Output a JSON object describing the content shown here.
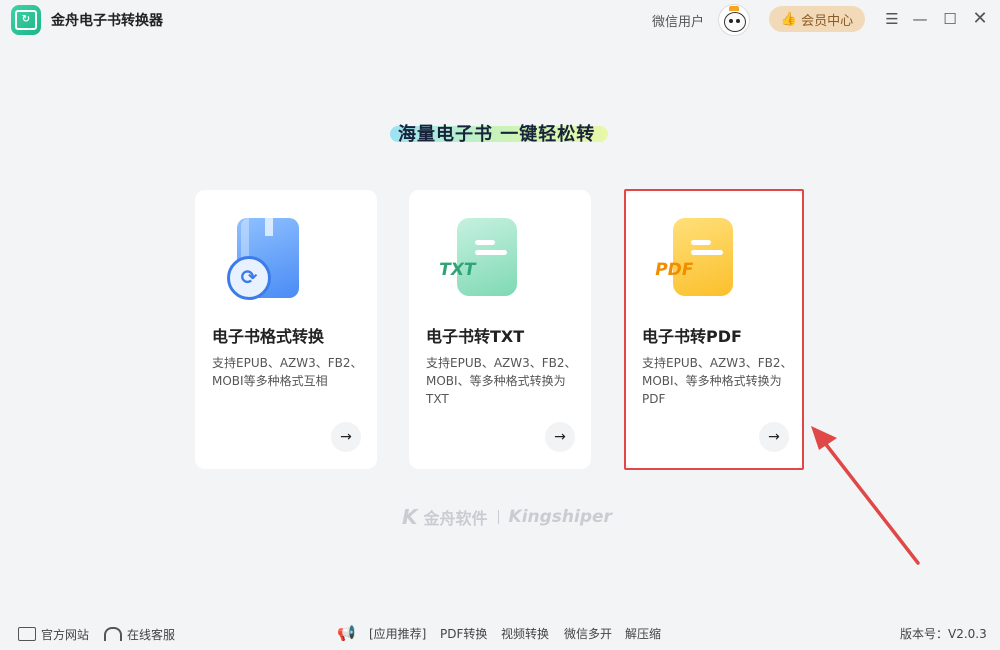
{
  "app": {
    "title": "金舟电子书转换器",
    "logo_icon": "refresh-book-icon"
  },
  "header": {
    "user_name": "微信用户",
    "vip_label": "会员中心",
    "menu_icon": "menu-icon",
    "min_icon": "minimize-icon",
    "max_icon": "maximize-icon",
    "close_icon": "close-icon"
  },
  "slogan": "海量电子书  一键轻松转",
  "cards": [
    {
      "title": "电子书格式转换",
      "desc": "支持EPUB、AZW3、FB2、MOBI等多种格式互相",
      "icon": "book-sync-icon",
      "arrow": "→"
    },
    {
      "title": "电子书转TXT",
      "desc": "支持EPUB、AZW3、FB2、MOBI、等多种格式转换为TXT",
      "icon": "txt-doc-icon",
      "icon_label": "TXT",
      "arrow": "→"
    },
    {
      "title": "电子书转PDF",
      "desc": "支持EPUB、AZW3、FB2、MOBI、等多种格式转换为PDF",
      "icon": "pdf-doc-icon",
      "icon_label": "PDF",
      "arrow": "→"
    }
  ],
  "brand": {
    "cn": "金舟软件",
    "en": "Kingshiper"
  },
  "footer": {
    "site": "官方网站",
    "service": "在线客服",
    "links": [
      "[应用推荐]",
      "PDF转换",
      "视频转换",
      "微信多开",
      "解压缩"
    ],
    "version": "版本号：V2.0.3"
  },
  "colors": {
    "accent": "#1bb58a",
    "highlight": "#e04848",
    "vip_bg": "#f2d9b8"
  }
}
